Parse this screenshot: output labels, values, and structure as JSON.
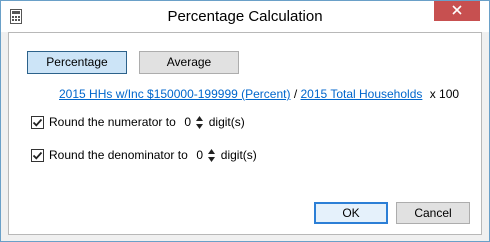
{
  "window": {
    "title": "Percentage Calculation",
    "icon": "calculator-icon",
    "close_icon": "close-icon"
  },
  "tabs": [
    {
      "label": "Percentage",
      "active": true
    },
    {
      "label": "Average",
      "active": false
    }
  ],
  "formula": {
    "numerator_link": "2015 HHs w/Inc $150000-199999 (Percent)",
    "separator": " / ",
    "denominator_link": "2015 Total Households",
    "multiplier": "x 100"
  },
  "round_numerator": {
    "checked": true,
    "label": "Round the numerator to",
    "value": "0",
    "suffix": "digit(s)"
  },
  "round_denominator": {
    "checked": true,
    "label": "Round the denominator to",
    "value": "0",
    "suffix": "digit(s)"
  },
  "buttons": {
    "ok": "OK",
    "cancel": "Cancel"
  },
  "colors": {
    "link": "#0066cc",
    "active_tab": "#cce4f7",
    "window_border": "#6aa0c8"
  }
}
